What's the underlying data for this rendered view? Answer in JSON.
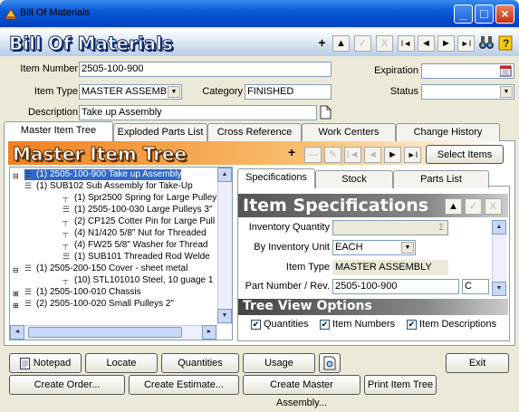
{
  "window": {
    "title": "Bill Of Materials",
    "min": "_",
    "max": "□",
    "close": "×"
  },
  "banner": {
    "title": "Bill Of Materials"
  },
  "nav": {
    "add": "+",
    "up": "▲",
    "check": "✓",
    "cancel": "X",
    "first": "I◄",
    "prev": "◄",
    "next": "►",
    "last": "►I"
  },
  "form": {
    "item_number_label": "Item Number",
    "item_number": "2505-100-900",
    "expiration_label": "Expiration",
    "expiration": "",
    "item_type_label": "Item Type",
    "item_type": "MASTER ASSEMBLY",
    "category_label": "Category",
    "category": "FINISHED",
    "status_label": "Status",
    "status": "",
    "description_label": "Description",
    "description": "Take up Assembly"
  },
  "tabs": [
    "Master Item Tree",
    "Exploded Parts List",
    "Cross Reference List",
    "Work Centers",
    "Change History"
  ],
  "mtt": {
    "title": "Master Item Tree",
    "select_items": "Select Items"
  },
  "tree": [
    {
      "text": "(1) 2505-100-900  Take up Assembly",
      "selected": true
    },
    {
      "text": "(1) SUB102  Sub Assembly for Take-Up"
    },
    {
      "text": "(1) Spr2500  Spring for Large Pulley"
    },
    {
      "text": "(1) 2505-100-030  Large Pulleys 3\""
    },
    {
      "text": "(2) CP125  Cotter Pin for Large Pull"
    },
    {
      "text": "(4) N1/420  5/8\" Nut for Threaded"
    },
    {
      "text": "(4) FW25  5/8\" Washer for Thread"
    },
    {
      "text": "(1) SUB101  Threaded Rod Welde"
    },
    {
      "text": "(1) 2505-200-150  Cover - sheet metal"
    },
    {
      "text": "(10) STL101010  Steel, 10 guage 1"
    },
    {
      "text": "(1) 2505-100-010  Chassis"
    },
    {
      "text": "(2) 2505-100-020  Small Pulleys 2\""
    }
  ],
  "subtabs": [
    "Specifications",
    "Stock",
    "Parts List"
  ],
  "spec": {
    "title": "Item Specifications",
    "inv_qty_label": "Inventory Quantity",
    "inv_qty": "1",
    "by_unit_label": "By Inventory Unit",
    "by_unit": "EACH",
    "item_type_label": "Item Type",
    "item_type": "MASTER ASSEMBLY",
    "part_label": "Part Number / Rev.",
    "part": "2505-100-900",
    "rev": "C"
  },
  "treeview": {
    "title": "Tree View Options",
    "opt1": "Quantities",
    "opt2": "Item Numbers",
    "opt3": "Item Descriptions"
  },
  "buttons": {
    "notepad": "Notepad",
    "locate": "Locate",
    "quantities": "Quantities",
    "usage": "Usage",
    "exit": "Exit",
    "create_order": "Create Order...",
    "create_estimate": "Create Estimate...",
    "create_master": "Create Master Assembly...",
    "print_tree": "Print Item Tree"
  }
}
